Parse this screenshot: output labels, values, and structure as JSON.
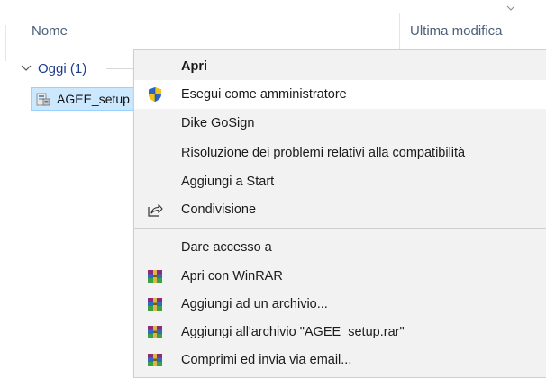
{
  "explorer": {
    "columns": {
      "name": "Nome",
      "modified": "Ultima modifica"
    },
    "group": {
      "label": "Oggi (1)"
    },
    "file": {
      "name": "AGEE_setup"
    }
  },
  "context_menu": {
    "items": [
      {
        "label": "Apri",
        "bold": true
      },
      {
        "label": "Esegui come amministratore",
        "icon": "uac-shield-icon"
      },
      {
        "label": "Dike GoSign"
      },
      {
        "label": "Risoluzione dei problemi relativi alla compatibilità"
      },
      {
        "label": "Aggiungi a Start"
      },
      {
        "label": "Condivisione",
        "icon": "share-icon"
      },
      {
        "label": "Dare accesso a"
      },
      {
        "label": "Apri con WinRAR",
        "icon": "winrar-icon"
      },
      {
        "label": "Aggiungi ad un archivio...",
        "icon": "winrar-icon"
      },
      {
        "label": "Aggiungi all'archivio \"AGEE_setup.rar\"",
        "icon": "winrar-icon"
      },
      {
        "label": "Comprimi ed invia via email...",
        "icon": "winrar-icon"
      }
    ]
  },
  "colors": {
    "selection": "#cce8ff",
    "menu_bg": "#f2f2f2",
    "hover": "#ffffff",
    "group_text": "#1e3c8c"
  }
}
